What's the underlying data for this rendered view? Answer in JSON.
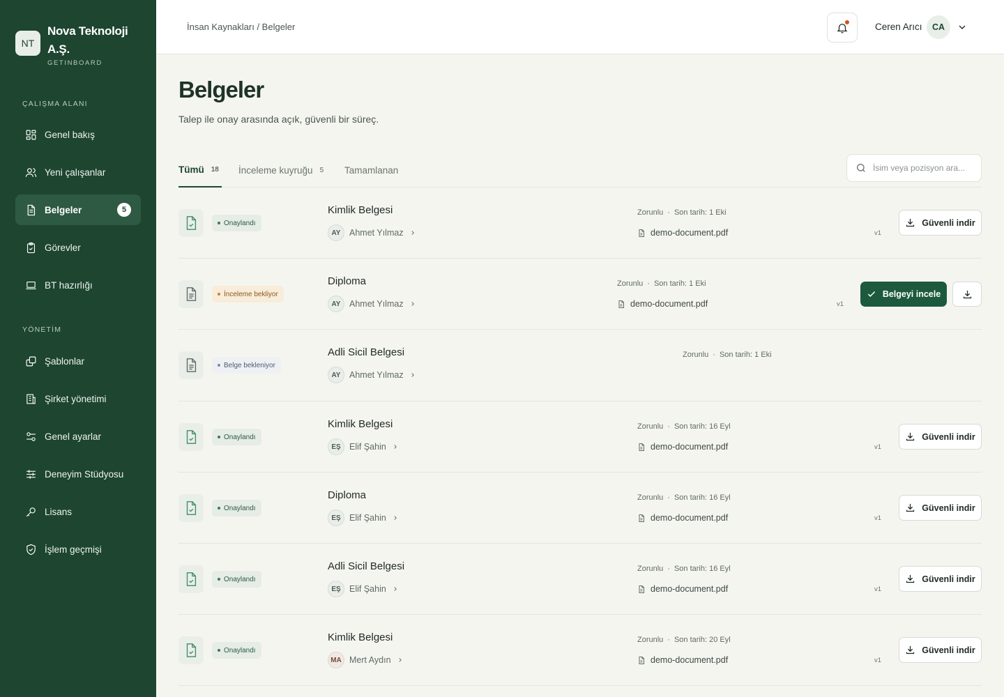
{
  "app": {
    "org_initials": "NT",
    "org_name": "Nova Teknoloji A.Ş.",
    "org_sub": "GETINBOARD"
  },
  "sidebar": {
    "workspace_label": "ÇALIŞMA ALANI",
    "management_label": "YÖNETİM",
    "items": [
      {
        "label": "Genel bakış",
        "icon": "grid-icon"
      },
      {
        "label": "Yeni çalışanlar",
        "icon": "users-icon"
      },
      {
        "label": "Belgeler",
        "icon": "document-icon",
        "badge": "5",
        "active": true
      },
      {
        "label": "Görevler",
        "icon": "clipboard-check-icon"
      },
      {
        "label": "BT hazırlığı",
        "icon": "laptop-icon"
      },
      {
        "label": "Şablonlar",
        "icon": "copy-icon"
      },
      {
        "label": "Şirket yönetimi",
        "icon": "building-icon"
      },
      {
        "label": "Genel ayarlar",
        "icon": "toggles-icon"
      },
      {
        "label": "Deneyim Stüdyosu",
        "icon": "sliders-icon"
      },
      {
        "label": "Lisans",
        "icon": "key-icon"
      },
      {
        "label": "İşlem geçmişi",
        "icon": "shield-check-icon"
      }
    ]
  },
  "header": {
    "breadcrumb": "İnsan Kaynakları / Belgeler",
    "user_name": "Ceren Arıcı",
    "user_initials": "CA"
  },
  "main": {
    "title": "Belgeler",
    "subtitle": "Talep ile onay arasında açık, güvenli bir süreç.",
    "tabs": [
      {
        "label": "Tümü",
        "count": "18",
        "active": true
      },
      {
        "label": "İnceleme kuyruğu",
        "count": "5"
      },
      {
        "label": "Tamamlanan",
        "count": ""
      }
    ],
    "search_placeholder": "İsim veya pozisyon ara..."
  },
  "labels": {
    "required": "Zorunlu",
    "dot": "·",
    "download": "Güvenli indir",
    "review": "Belgeyi incele"
  },
  "colors": {
    "sidebar_bg": "#1d4530",
    "accent": "#1d5a3d",
    "notification": "#d2541f"
  },
  "documents": [
    {
      "status": "Onaylandı",
      "status_kind": "approved",
      "title": "Kimlik Belgesi",
      "person_initials": "AY",
      "person": "Ahmet Yılmaz",
      "deadline": "Son tarih: 1 Eki",
      "file": "demo-document.pdf",
      "version": "v1",
      "action": "download"
    },
    {
      "status": "İnceleme bekliyor",
      "status_kind": "review",
      "title": "Diploma",
      "person_initials": "AY",
      "person": "Ahmet Yılmaz",
      "deadline": "Son tarih: 1 Eki",
      "file": "demo-document.pdf",
      "version": "v1",
      "action": "review"
    },
    {
      "status": "Belge bekleniyor",
      "status_kind": "waiting",
      "title": "Adli Sicil Belgesi",
      "person_initials": "AY",
      "person": "Ahmet Yılmaz",
      "deadline": "Son tarih: 1 Eki",
      "file": "",
      "version": "",
      "action": "none"
    },
    {
      "status": "Onaylandı",
      "status_kind": "approved",
      "title": "Kimlik Belgesi",
      "person_initials": "EŞ",
      "person": "Elif Şahin",
      "deadline": "Son tarih: 16 Eyl",
      "file": "demo-document.pdf",
      "version": "v1",
      "action": "download"
    },
    {
      "status": "Onaylandı",
      "status_kind": "approved",
      "title": "Diploma",
      "person_initials": "EŞ",
      "person": "Elif Şahin",
      "deadline": "Son tarih: 16 Eyl",
      "file": "demo-document.pdf",
      "version": "v1",
      "action": "download"
    },
    {
      "status": "Onaylandı",
      "status_kind": "approved",
      "title": "Adli Sicil Belgesi",
      "person_initials": "EŞ",
      "person": "Elif Şahin",
      "deadline": "Son tarih: 16 Eyl",
      "file": "demo-document.pdf",
      "version": "v1",
      "action": "download"
    },
    {
      "status": "Onaylandı",
      "status_kind": "approved",
      "title": "Kimlik Belgesi",
      "person_initials": "MA",
      "person": "Mert Aydın",
      "deadline": "Son tarih: 20 Eyl",
      "file": "demo-document.pdf",
      "version": "v1",
      "action": "download"
    }
  ]
}
